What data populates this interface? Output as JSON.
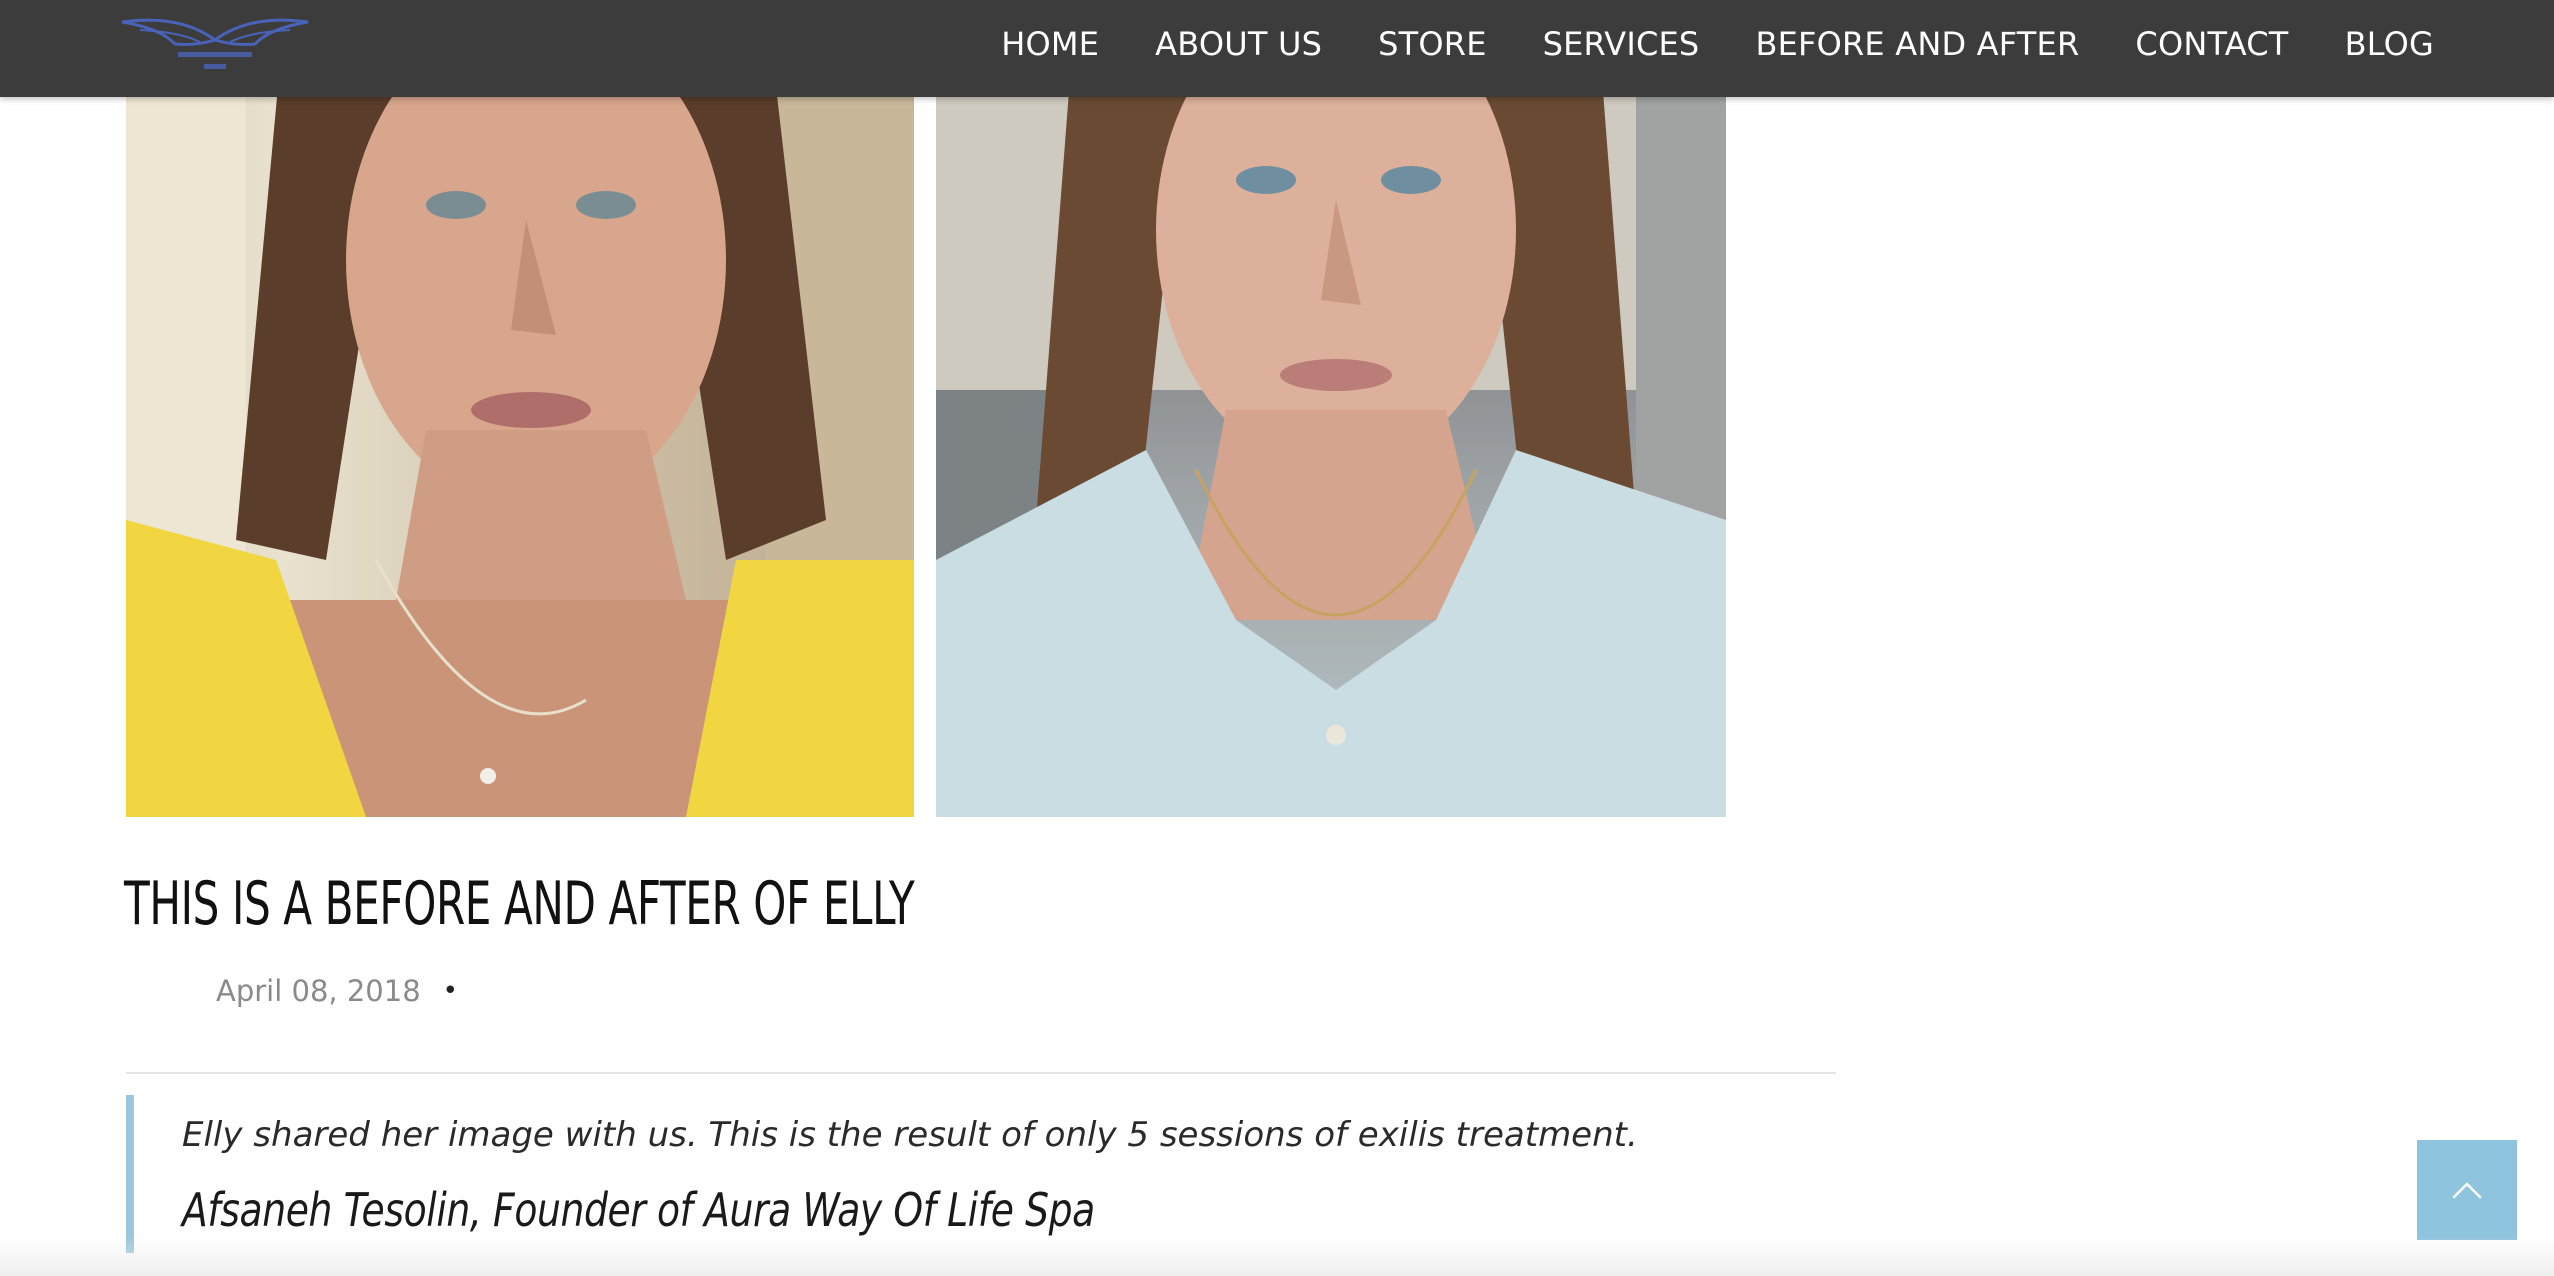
{
  "header": {
    "logo_alt": "Aura Way Of Life Spa",
    "logo_color": "#4a63b8",
    "nav_items": [
      {
        "label": "HOME"
      },
      {
        "label": "ABOUT US"
      },
      {
        "label": "STORE"
      },
      {
        "label": "SERVICES"
      },
      {
        "label": "BEFORE AND AFTER"
      },
      {
        "label": "CONTACT"
      },
      {
        "label": "BLOG"
      }
    ]
  },
  "post": {
    "images": [
      {
        "label": "before",
        "shirt_color": "#f1d642"
      },
      {
        "label": "after",
        "shirt_color": "#c9dde2"
      }
    ],
    "title": "THIS IS A BEFORE AND AFTER OF ELLY",
    "date": "April 08, 2018",
    "meta_separator": "•",
    "quote": "Elly shared her image with us. This is the result of only 5 sessions of exilis treatment.",
    "quote_author": "Afsaneh Tesolin, Founder of Aura Way Of Life Spa"
  },
  "colors": {
    "nav_background": "#3c3c3c",
    "quote_border": "#9bc6dc",
    "back_to_top": "#8fc4de"
  },
  "back_to_top": {
    "icon": "chevron-up-icon"
  }
}
